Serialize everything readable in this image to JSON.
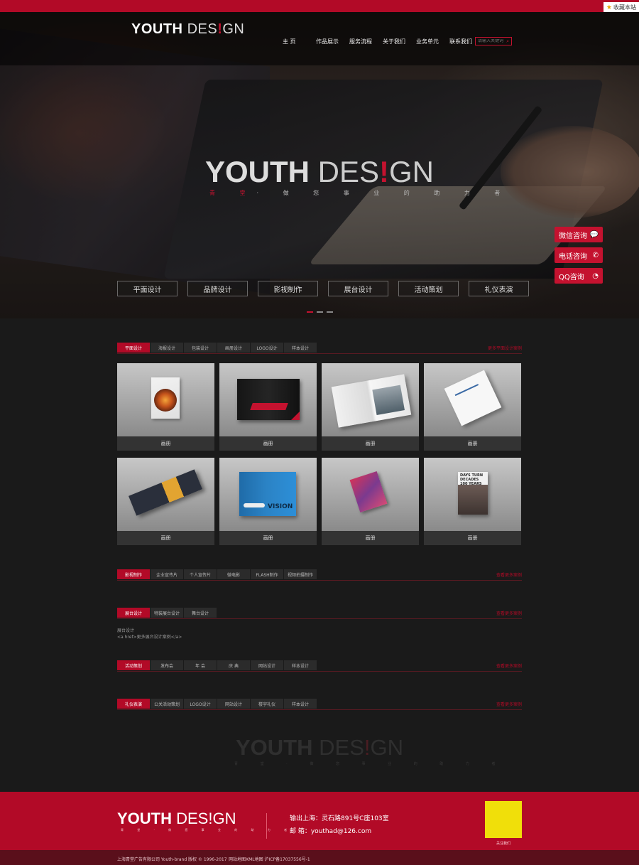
{
  "topbar": {
    "favorite_label": "收藏本站"
  },
  "header": {
    "logo_bold": "YOUTH",
    "logo_thin_a": "DES",
    "logo_excl": "!",
    "logo_thin_b": "GN",
    "nav": [
      "主 页",
      "作品展示",
      "服务流程",
      "关于我们",
      "业务单元",
      "联系我们"
    ],
    "search_placeholder": "请输入关键词"
  },
  "hero": {
    "brand_bold": "YOUTH",
    "brand_thin_a": "DES",
    "brand_excl": "!",
    "brand_thin_b": "GN",
    "tagline_red": "青 堂",
    "tagline": "· 做 您 事 业 的 助 力 者",
    "categories": [
      "平面设计",
      "品牌设计",
      "影视制作",
      "展台设计",
      "活动策划",
      "礼仪表演"
    ],
    "side_buttons": [
      {
        "label": "微信咨询",
        "icon": "chat-bubble-icon"
      },
      {
        "label": "电话咨询",
        "icon": "phone-icon"
      },
      {
        "label": "QQ咨询",
        "icon": "qq-icon"
      }
    ]
  },
  "sections": {
    "graphic": {
      "tabs": [
        "平面设计",
        "海报设计",
        "包装设计",
        "画册设计",
        "LOGO设计",
        "样本设计"
      ],
      "more": "更多平面设计案例"
    },
    "gallery": {
      "captions": [
        "画册",
        "画册",
        "画册",
        "画册",
        "画册",
        "画册",
        "画册",
        "画册"
      ]
    },
    "video": {
      "tabs": [
        "影视制作",
        "企业宣传片",
        "个人宣传片",
        "微电影",
        "FLASH制作",
        "视频拍摄制作"
      ],
      "more": "查看更多案例"
    },
    "booth": {
      "tabs": [
        "展台设计",
        "特装展台设计",
        "舞台设计"
      ],
      "more": "查看更多案例"
    },
    "address": {
      "line1": "展台设计",
      "line2": "<a href>更多展台设计案例</a>"
    },
    "event": {
      "tabs": [
        "活动策划",
        "发布会",
        "年 会",
        "庆 典",
        "网站设计",
        "样本设计"
      ],
      "more": "查看更多案例"
    },
    "ceremony": {
      "tabs": [
        "礼仪表演",
        "公关活动策划",
        "LOGO设计",
        "网站设计",
        "楼宇礼仪",
        "样本设计"
      ],
      "more": "查看更多案例"
    }
  },
  "ghost": {
    "brand_bold": "YOUTH",
    "brand_thin_a": "DES",
    "brand_excl": "!",
    "brand_thin_b": "GN",
    "tagline": "青 堂 · 做 您 事 业 的 助 力 者"
  },
  "footer": {
    "logo_bold": "YOUTH",
    "logo_thin_a": "DES",
    "logo_excl": "!",
    "logo_thin_b": "GN",
    "tagline": "青 堂 · 做 您 事 业 的 助 力 者",
    "address": "输出上海：灵石路891号C座103室",
    "email": "邮  箱：youthad@126.com",
    "qr_caption": "关注我们",
    "copyright": "上海青堂广告有限公司 Youth-brand 版权 © 1996-2017",
    "icp": "网站地图XML地图  沪ICP备17037556号-1"
  },
  "colors": {
    "accent": "#b20a27",
    "background": "#1a1a1a",
    "qr": "#f0df0a"
  }
}
